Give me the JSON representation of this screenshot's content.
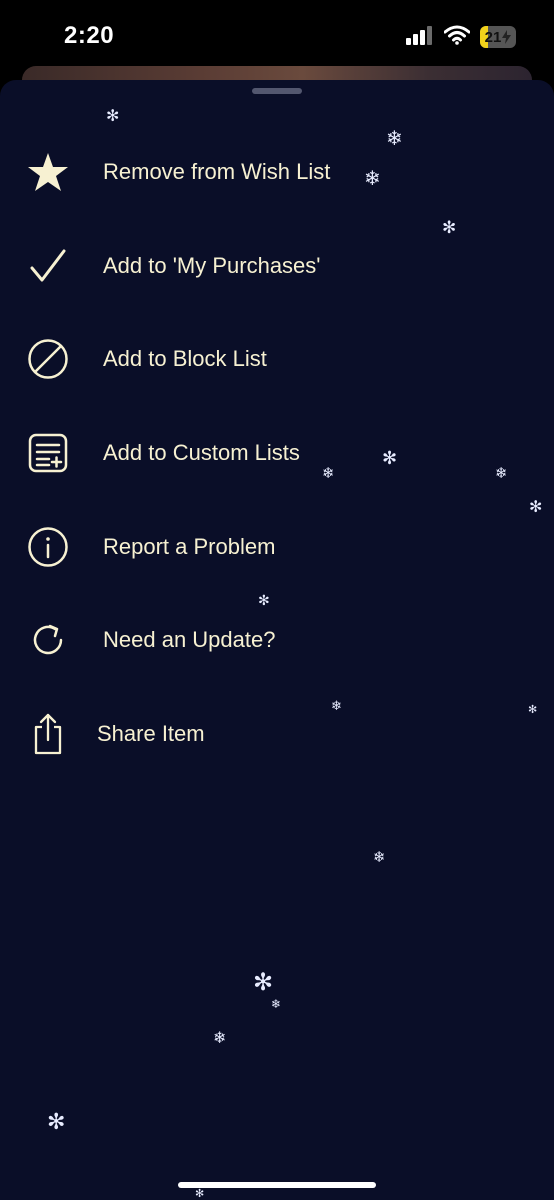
{
  "status_bar": {
    "time": "2:20",
    "battery": "21",
    "battery_level": 0.21,
    "battery_color": "#f2d21b",
    "icons": [
      "cellular-signal-icon",
      "wifi-icon",
      "battery-charging-icon"
    ]
  },
  "sheet": {
    "background": "#0a0e28",
    "text_color": "#f7f1d2",
    "menu_items": [
      {
        "label": "Remove from Wish List",
        "icon": "star-icon"
      },
      {
        "label": "Add to 'My Purchases'",
        "icon": "checkmark-icon"
      },
      {
        "label": "Add to Block List",
        "icon": "block-icon"
      },
      {
        "label": "Add to Custom Lists",
        "icon": "custom-list-add-icon"
      },
      {
        "label": "Report a Problem",
        "icon": "info-icon"
      },
      {
        "label": "Need an Update?",
        "icon": "refresh-icon"
      },
      {
        "label": "Share Item",
        "icon": "share-icon"
      }
    ]
  }
}
